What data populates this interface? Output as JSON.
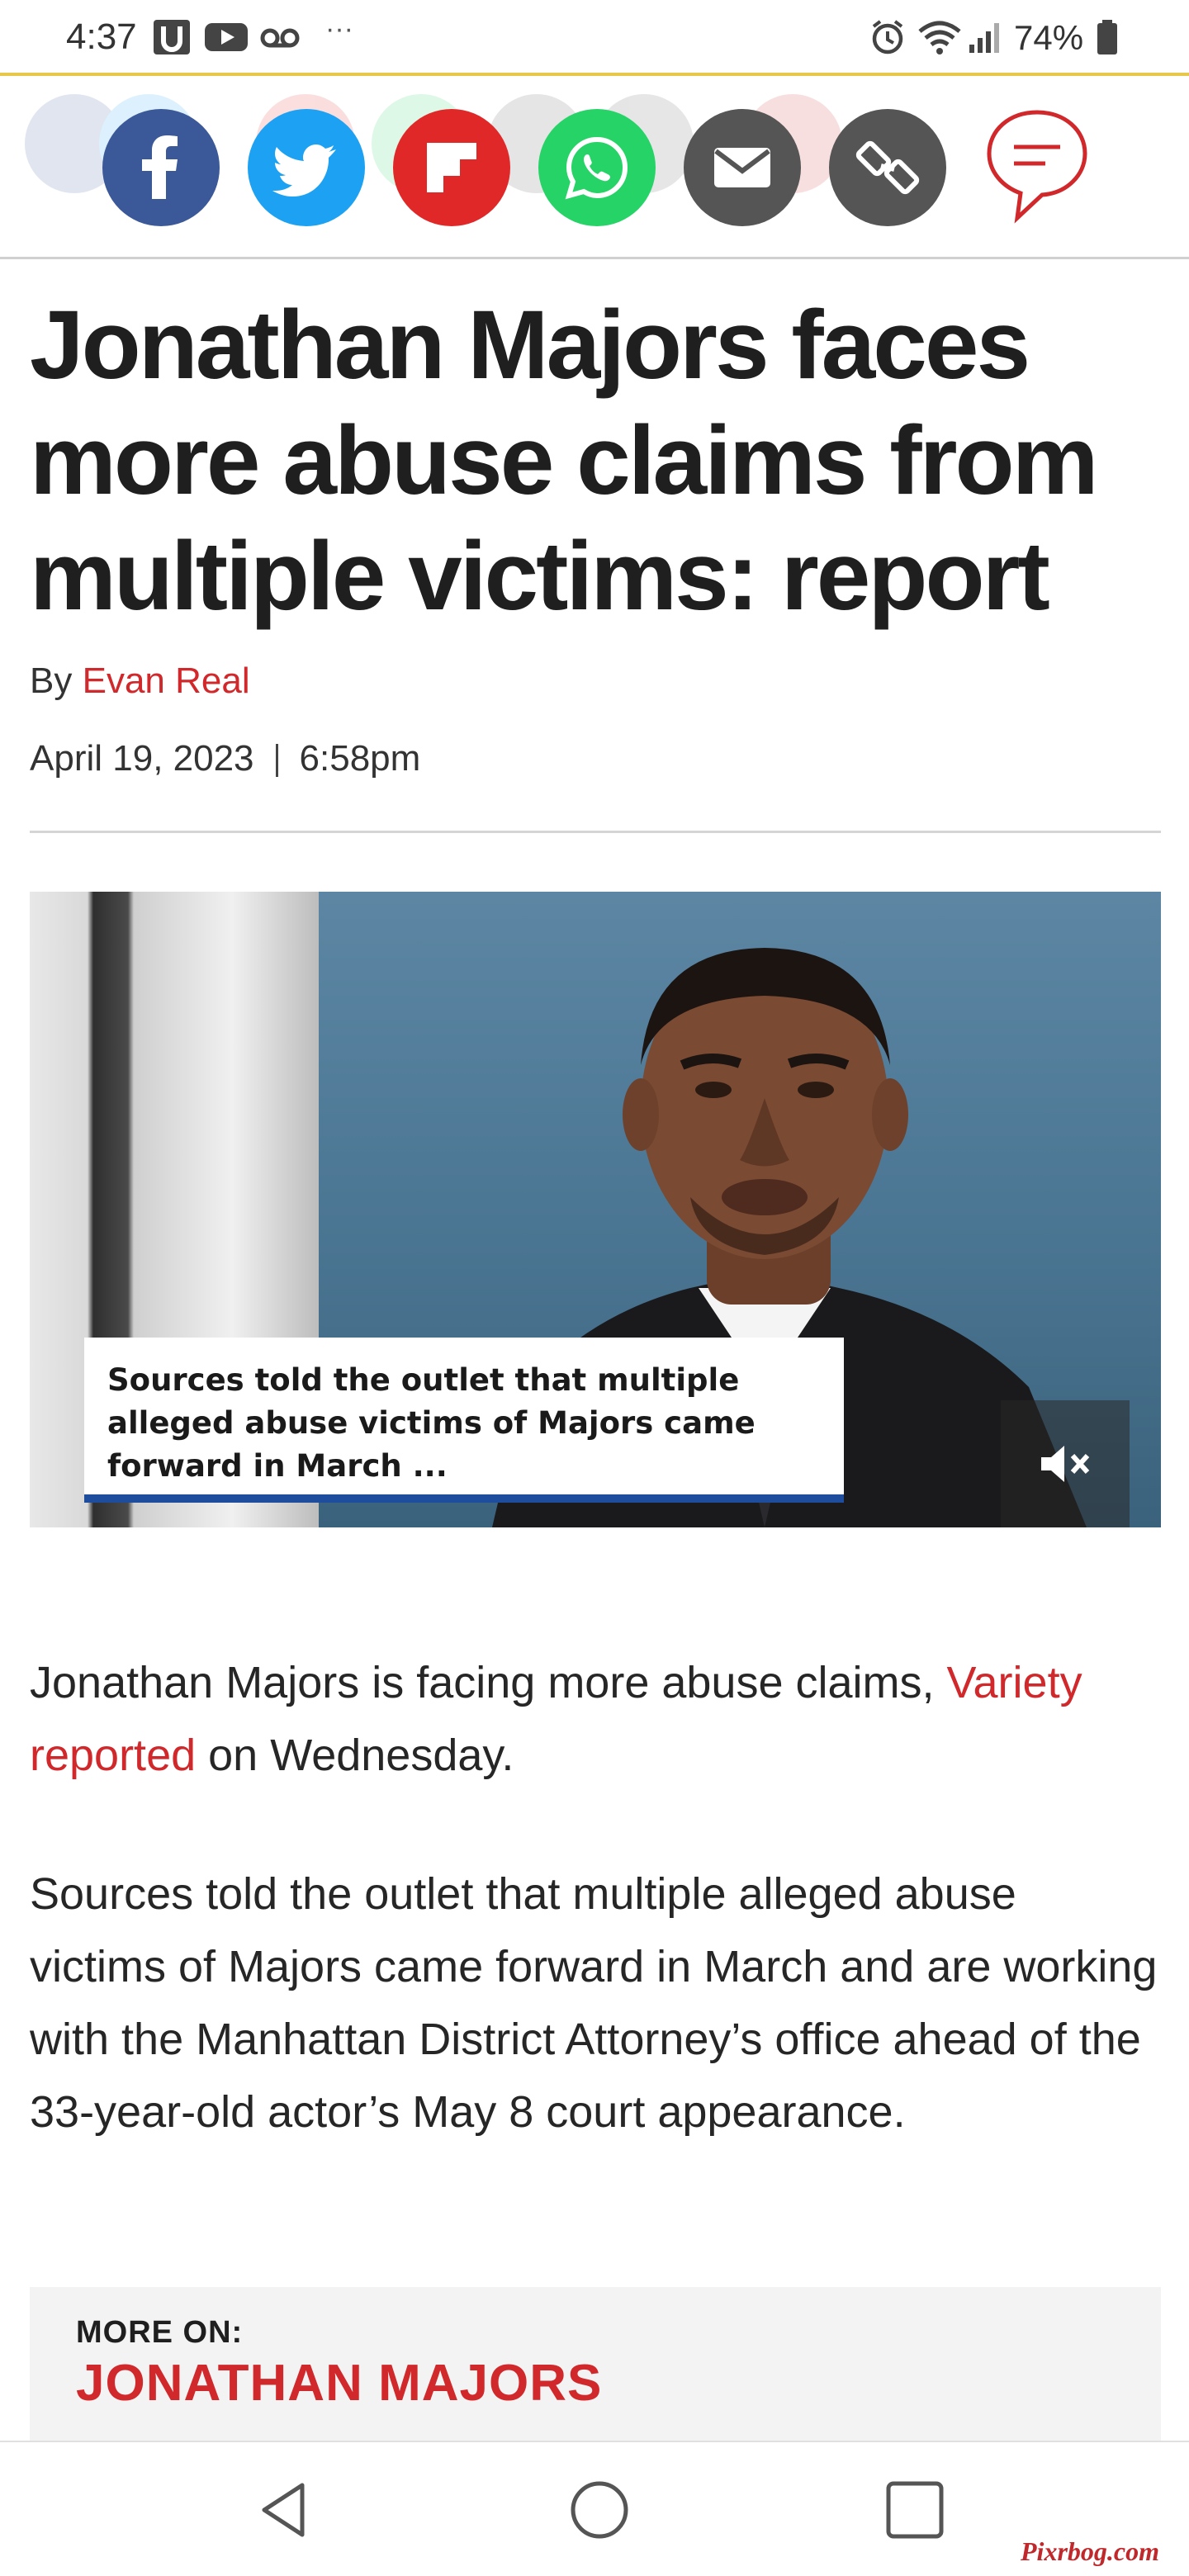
{
  "status_bar": {
    "time": "4:37",
    "more_indicator": "···",
    "battery": "74%",
    "icons": [
      "u-app-icon",
      "youtube-icon",
      "voicemail-icon",
      "alarm-icon",
      "wifi-icon",
      "signal-icon",
      "battery-icon"
    ]
  },
  "share_bar": {
    "buttons": [
      {
        "name": "facebook",
        "color": "#3b5998"
      },
      {
        "name": "twitter",
        "color": "#1da1f2"
      },
      {
        "name": "flipboard",
        "color": "#e12828"
      },
      {
        "name": "whatsapp",
        "color": "#25d366"
      },
      {
        "name": "email",
        "color": "#555555"
      },
      {
        "name": "copy-link",
        "color": "#555555"
      }
    ],
    "comments_icon": "comments-icon",
    "accent": "#d0282b"
  },
  "article": {
    "headline": "Jonathan Majors faces more abuse claims from multiple victims: report",
    "by_label": "By",
    "author": "Evan Real",
    "date": "April 19, 2023",
    "time": "6:58pm",
    "video": {
      "caption": "Sources told the outlet that multiple alleged abuse victims of Majors came forward in March ...",
      "mute_icon": "mute-icon"
    },
    "paragraph_1": {
      "before": "Jonathan Majors is facing more abuse claims, ",
      "link": "Variety reported",
      "after": " on Wednesday."
    },
    "paragraph_2": "Sources told the outlet that multiple alleged abuse victims of Majors came forward in March and are working with the Manhattan District Attorney’s office ahead of the 33-year-old actor’s May 8 court appearance.",
    "more_on": {
      "label": "MORE ON:",
      "topic": "JONATHAN MAJORS"
    }
  },
  "nav_bar": {
    "icons": [
      "back-icon",
      "home-icon",
      "recents-icon"
    ]
  },
  "watermark": "Pixrbog.com"
}
